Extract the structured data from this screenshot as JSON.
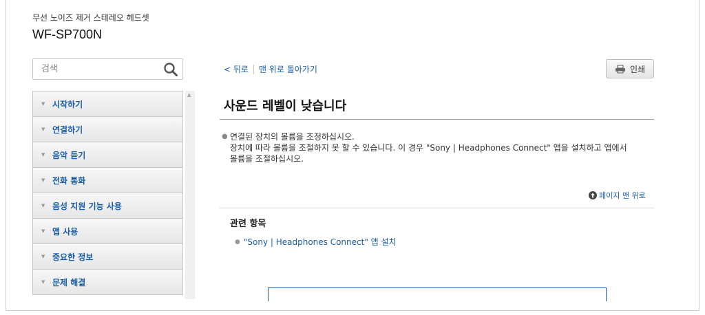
{
  "header": {
    "product_line": "무선 노이즈 제거 스테레오 헤드셋",
    "model": "WF-SP700N"
  },
  "search": {
    "placeholder": "검색",
    "icon": "search-icon"
  },
  "sidebar": {
    "items": [
      {
        "label": "시작하기"
      },
      {
        "label": "연결하기"
      },
      {
        "label": "음악 듣기"
      },
      {
        "label": "전화 통화"
      },
      {
        "label": "음성 지원 기능 사용"
      },
      {
        "label": "앱 사용"
      },
      {
        "label": "중요한 정보"
      },
      {
        "label": "문제 해결"
      }
    ]
  },
  "topbar": {
    "back_label": "< 뒤로",
    "top_label": "맨 위로 돌아가기"
  },
  "print": {
    "label": "인쇄",
    "icon": "printer-icon"
  },
  "content": {
    "title": "사운드 레벨이 낮습니다",
    "lines": [
      "연결된 장치의 볼륨을 조정하십시오.",
      "장치에 따라 볼륨을 조절하지 못 할 수 있습니다. 이 경우 \"Sony | Headphones Connect\" 앱을 설치하고 앱에서",
      "볼륨을 조절하십시오."
    ],
    "back_to_top": "페이지 맨 위로",
    "related_heading": "관련 항목",
    "related_links": [
      {
        "label": "\"Sony | Headphones Connect\" 앱 설치"
      }
    ]
  },
  "colors": {
    "link": "#1a5fa6",
    "text": "#333333"
  }
}
